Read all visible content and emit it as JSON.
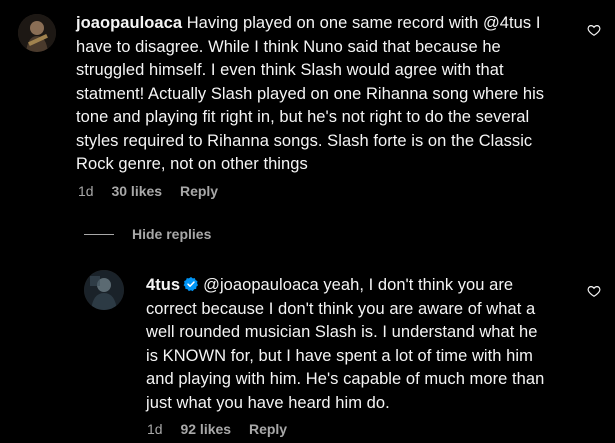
{
  "comment": {
    "username": "joaopauloaca",
    "lines": [
      "Having played on one same record with @4tus I",
      "have to disagree. While I think Nuno said that because he",
      "struggled himself. I even think Slash would agree with that",
      "statment! Actually Slash played on one Rihanna song where his",
      "tone and playing fit right in, but he's not right to do the several",
      "styles required to Rihanna songs. Slash forte is on the Classic",
      "Rock genre, not on other things"
    ],
    "time": "1d",
    "likes": "30 likes",
    "reply_label": "Reply"
  },
  "replies_toggle": "Hide replies",
  "reply": {
    "username": "4tus",
    "mention": "@joaopauloaca",
    "lines": [
      "yeah, I don't think you are",
      "correct because I don't think you are aware of what a",
      "well rounded musician Slash is. I understand what he",
      "is KNOWN for, but I have spent a lot of time with him",
      "and playing with him. He's capable of much more than",
      "just what you have heard him do."
    ],
    "time": "1d",
    "likes": "92 likes",
    "reply_label": "Reply"
  },
  "colors": {
    "background": "#000000",
    "text": "#f5f5f5",
    "secondary": "#a8a8a8",
    "verified": "#0095f6"
  },
  "icons": [
    "heart-icon",
    "verified-badge-icon"
  ]
}
